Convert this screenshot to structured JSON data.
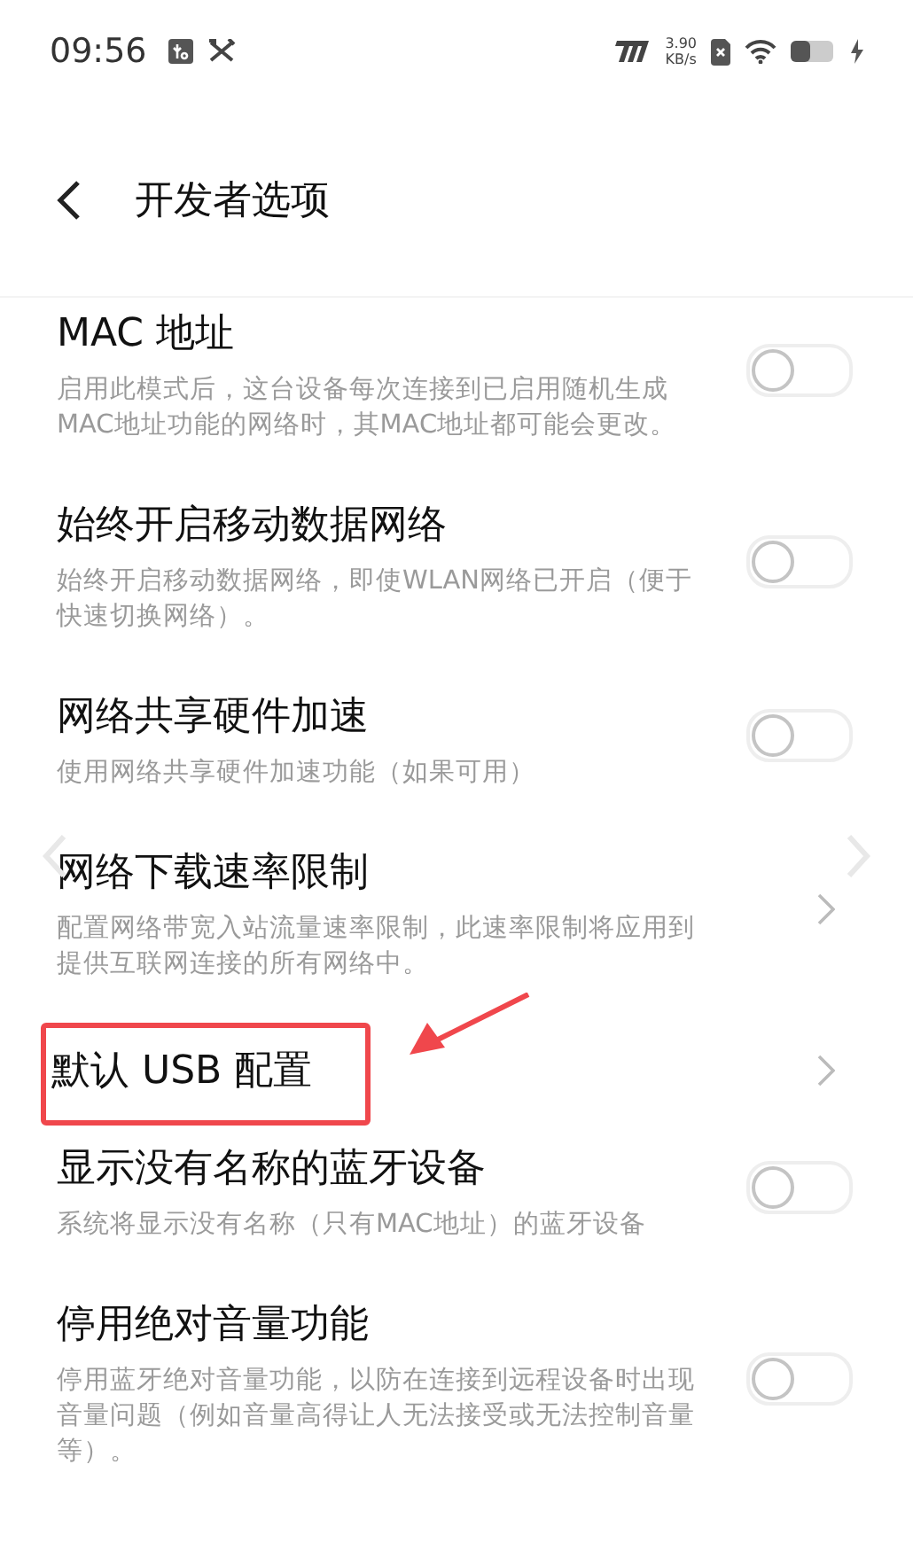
{
  "status_bar": {
    "time": "09:56",
    "speed_value": "3.90",
    "speed_unit": "KB/s"
  },
  "header": {
    "title": "开发者选项"
  },
  "items": [
    {
      "kind": "toggle",
      "title": "MAC 地址",
      "description": "启用此模式后，这台设备每次连接到已启用随机生成MAC地址功能的网络时，其MAC地址都可能会更改。",
      "on": false,
      "highlighted": false
    },
    {
      "kind": "toggle",
      "title": "始终开启移动数据网络",
      "description": "始终开启移动数据网络，即使WLAN网络已开启（便于快速切换网络）。",
      "on": false,
      "highlighted": false
    },
    {
      "kind": "toggle",
      "title": "网络共享硬件加速",
      "description": "使用网络共享硬件加速功能（如果可用）",
      "on": false,
      "highlighted": false
    },
    {
      "kind": "link",
      "title": "网络下载速率限制",
      "description": "配置网络带宽入站流量速率限制，此速率限制将应用到提供互联网连接的所有网络中。",
      "highlighted": false
    },
    {
      "kind": "link",
      "title": "默认 USB 配置",
      "highlighted": true
    },
    {
      "kind": "toggle",
      "title": "显示没有名称的蓝牙设备",
      "description": "系统将显示没有名称（只有MAC地址）的蓝牙设备",
      "on": false,
      "highlighted": false
    },
    {
      "kind": "toggle",
      "title": "停用绝对音量功能",
      "description": "停用蓝牙绝对音量功能，以防在连接到远程设备时出现音量问题（例如音量高得让人无法接受或无法控制音量等）。",
      "on": false,
      "highlighted": false
    }
  ]
}
